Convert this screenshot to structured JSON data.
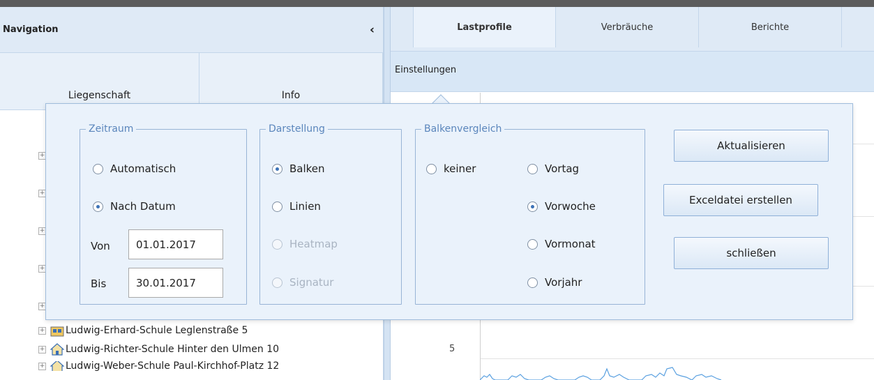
{
  "navigation": {
    "title": "Navigation",
    "collapse_icon": "chevron-left-icon",
    "tabs": [
      "Liegenschaft",
      "Info"
    ],
    "tree_items": [
      {
        "label": "Ludwig-Erhard-Schule Leglenstraße 5",
        "icon": "building-icon"
      },
      {
        "label": "Ludwig-Richter-Schule Hinter den Ulmen 10",
        "icon": "house-icon"
      },
      {
        "label": "Ludwig-Weber-Schule Paul-Kirchhof-Platz 12",
        "icon": "house-icon"
      }
    ]
  },
  "main": {
    "tabs": [
      {
        "label": "Lastprofile",
        "active": true
      },
      {
        "label": "Verbräuche",
        "active": false
      },
      {
        "label": "Berichte",
        "active": false
      }
    ],
    "subbar_label": "Einstellungen",
    "y_tick_visible": "5"
  },
  "settings": {
    "zeitraum": {
      "legend": "Zeitraum",
      "options": [
        {
          "label": "Automatisch",
          "checked": false
        },
        {
          "label": "Nach Datum",
          "checked": true
        }
      ],
      "von_label": "Von",
      "von_value": "01.01.2017",
      "bis_label": "Bis",
      "bis_value": "30.01.2017"
    },
    "darstellung": {
      "legend": "Darstellung",
      "options": [
        {
          "label": "Balken",
          "checked": true,
          "disabled": false
        },
        {
          "label": "Linien",
          "checked": false,
          "disabled": false
        },
        {
          "label": "Heatmap",
          "checked": false,
          "disabled": true
        },
        {
          "label": "Signatur",
          "checked": false,
          "disabled": true
        }
      ]
    },
    "balkenvergleich": {
      "legend": "Balkenvergleich",
      "options": [
        {
          "label": "keiner",
          "checked": false
        },
        {
          "label": "Vortag",
          "checked": false
        },
        {
          "label": "Vorwoche",
          "checked": true
        },
        {
          "label": "Vormonat",
          "checked": false
        },
        {
          "label": "Vorjahr",
          "checked": false
        }
      ]
    },
    "buttons": {
      "refresh": "Aktualisieren",
      "excel": "Exceldatei erstellen",
      "close": "schließen"
    }
  },
  "colors": {
    "accent": "#3d73b7",
    "panel": "#dfeaf6",
    "popup": "#eaf2fb",
    "chart_line": "#5aa0e0"
  }
}
